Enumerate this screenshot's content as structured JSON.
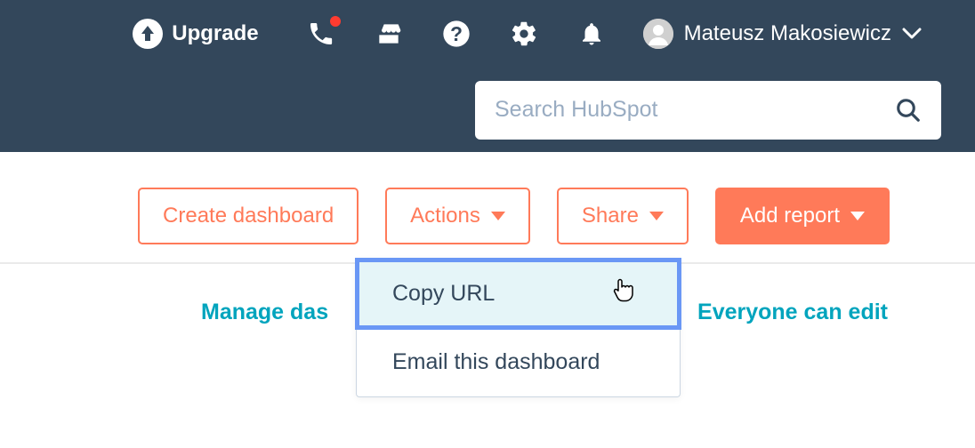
{
  "topbar": {
    "upgrade_label": "Upgrade",
    "user_name": "Mateusz Makosiewicz"
  },
  "search": {
    "placeholder": "Search HubSpot"
  },
  "toolbar": {
    "create_dashboard_label": "Create dashboard",
    "actions_label": "Actions",
    "share_label": "Share",
    "add_report_label": "Add report"
  },
  "share_menu": {
    "items": [
      {
        "label": "Copy URL"
      },
      {
        "label": "Email this dashboard"
      }
    ]
  },
  "footer": {
    "manage_label": "Manage das",
    "edit_label": "Everyone can edit"
  }
}
